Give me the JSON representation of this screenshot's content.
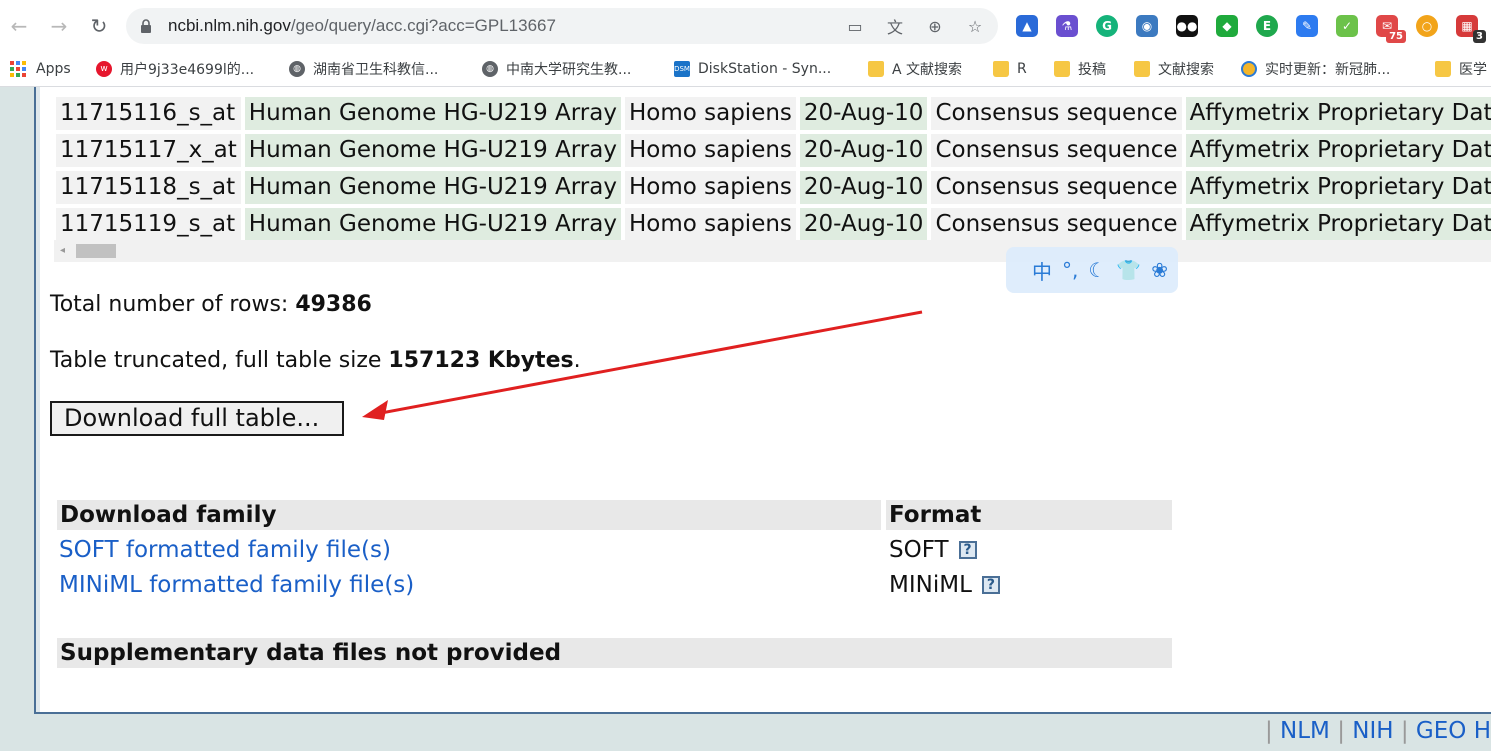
{
  "browser": {
    "url_host": "ncbi.nlm.nih.gov",
    "url_path": "/geo/query/acc.cgi?acc=GPL13667",
    "nav_back_icon": "arrow-left-icon",
    "nav_forward_icon": "arrow-right-icon",
    "reload_icon": "reload-icon",
    "extension_badges": {
      "mail": "75",
      "todo": "3"
    },
    "bookmarks": [
      {
        "label": "Apps",
        "icon": "apps-grid-icon"
      },
      {
        "label": "用户9j33e4699l的...",
        "icon": "weibo-icon"
      },
      {
        "label": "湖南省卫生科教信...",
        "icon": "globe-icon"
      },
      {
        "label": "中南大学研究生教...",
        "icon": "globe-icon"
      },
      {
        "label": "DiskStation - Syn...",
        "icon": "dsm-icon"
      },
      {
        "label": "A 文献搜索",
        "icon": "folder-icon"
      },
      {
        "label": "R",
        "icon": "folder-icon"
      },
      {
        "label": "投稿",
        "icon": "folder-icon"
      },
      {
        "label": "文献搜索",
        "icon": "folder-icon"
      },
      {
        "label": "实时更新：新冠肺...",
        "icon": "news-icon"
      },
      {
        "label": "医学",
        "icon": "folder-icon"
      }
    ]
  },
  "table": {
    "rows": [
      [
        "11715116_s_at",
        "Human Genome HG-U219 Array",
        "Homo sapiens",
        "20-Aug-10",
        "Consensus sequence",
        "Affymetrix Proprietary Data"
      ],
      [
        "11715117_x_at",
        "Human Genome HG-U219 Array",
        "Homo sapiens",
        "20-Aug-10",
        "Consensus sequence",
        "Affymetrix Proprietary Data"
      ],
      [
        "11715118_s_at",
        "Human Genome HG-U219 Array",
        "Homo sapiens",
        "20-Aug-10",
        "Consensus sequence",
        "Affymetrix Proprietary Data"
      ],
      [
        "11715119_s_at",
        "Human Genome HG-U219 Array",
        "Homo sapiens",
        "20-Aug-10",
        "Consensus sequence",
        "Affymetrix Proprietary Data"
      ]
    ]
  },
  "summary": {
    "total_rows_label": "Total number of rows: ",
    "total_rows_value": "49386",
    "truncated_label": "Table truncated, full table size ",
    "truncated_value": "157123 Kbytes",
    "truncated_suffix": "."
  },
  "download_button_label": "Download full table...",
  "family": {
    "header_label": "Download family",
    "header_format": "Format",
    "items": [
      {
        "label": "SOFT formatted family file(s)",
        "format": "SOFT"
      },
      {
        "label": "MINiML formatted family file(s)",
        "format": "MINiML"
      }
    ]
  },
  "supplementary_label": "Supplementary data files not provided",
  "ime_label": "中",
  "footer": {
    "links": [
      "NLM",
      "NIH",
      "GEO H"
    ],
    "separator": "|"
  },
  "colors": {
    "link": "#1a5fc7",
    "annotation_arrow": "#e02020",
    "green_cell": "#dfece0",
    "frame_border": "#4a6f96"
  }
}
